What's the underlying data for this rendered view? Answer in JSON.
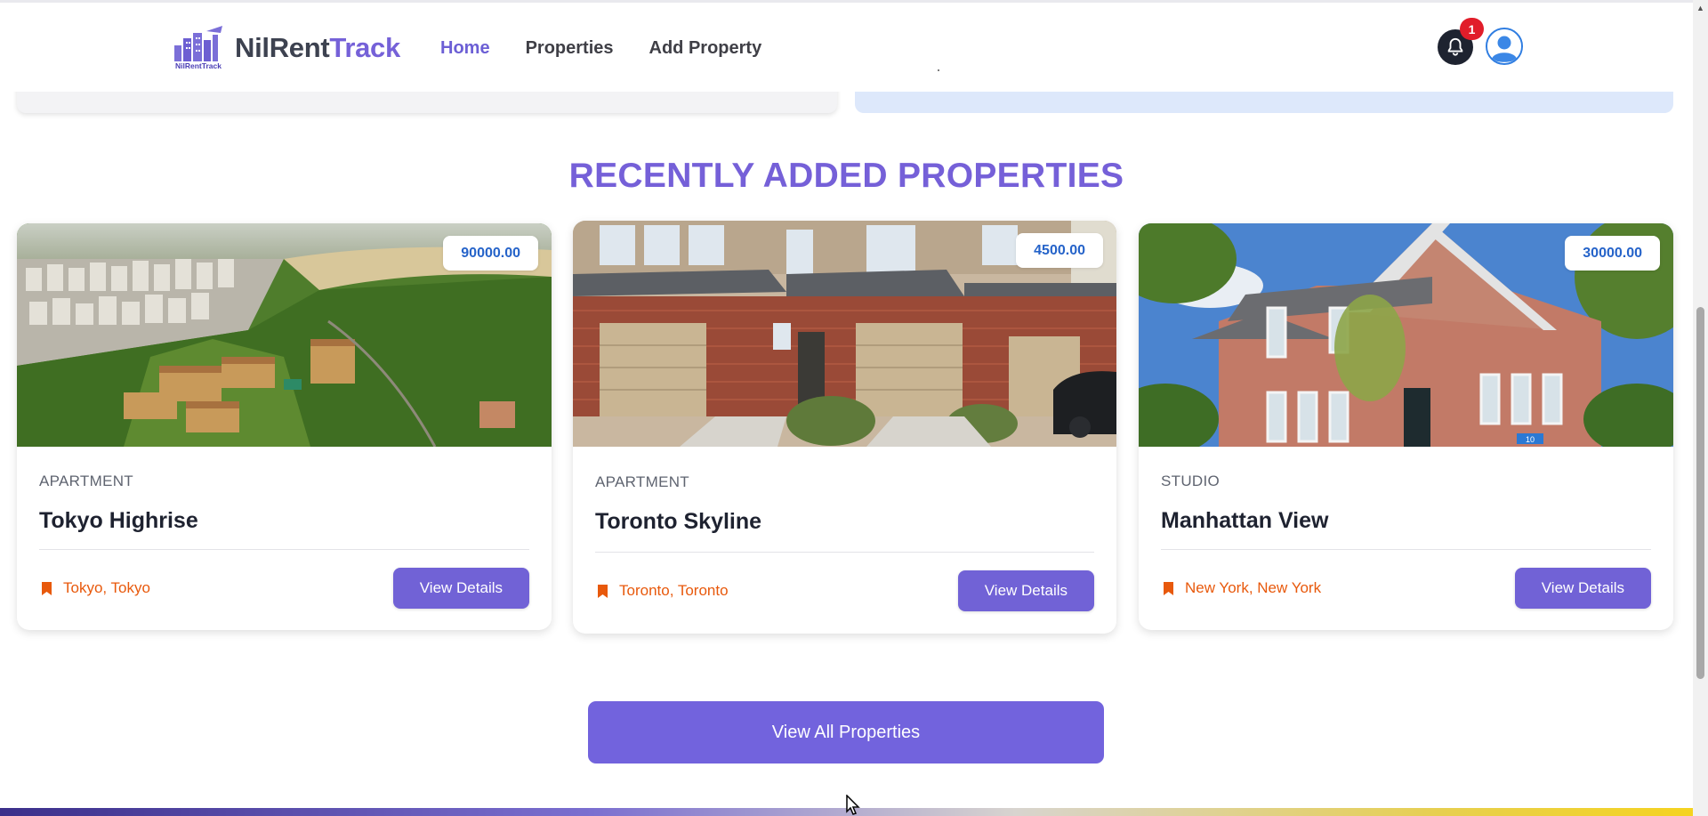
{
  "header": {
    "brand_main": "NilRent",
    "brand_accent": "Track",
    "logo_text": "NilRentTrack",
    "nav": [
      {
        "label": "Home",
        "active": true
      },
      {
        "label": "Properties",
        "active": false
      },
      {
        "label": "Add Property",
        "active": false
      }
    ],
    "notification_count": "1",
    "bell_icon": "bell-icon",
    "avatar_icon": "user-avatar-icon"
  },
  "section": {
    "title": "RECENTLY ADDED PROPERTIES"
  },
  "properties": [
    {
      "price": "90000.00",
      "type": "APARTMENT",
      "name": "Tokyo Highrise",
      "location": "Tokyo, Tokyo",
      "button": "View Details",
      "image": "aerial-city-forest-photo"
    },
    {
      "price": "4500.00",
      "type": "APARTMENT",
      "name": "Toronto Skyline",
      "location": "Toronto, Toronto",
      "button": "View Details",
      "image": "brick-townhouses-photo"
    },
    {
      "price": "30000.00",
      "type": "STUDIO",
      "name": "Manhattan View",
      "location": "New York, New York",
      "button": "View Details",
      "image": "brick-house-photo"
    }
  ],
  "view_all_label": "View All Properties",
  "colors": {
    "accent": "#7263dd",
    "title": "#7560d8",
    "price": "#2563c9",
    "location": "#e8590c",
    "badge": "#e11d2a"
  }
}
